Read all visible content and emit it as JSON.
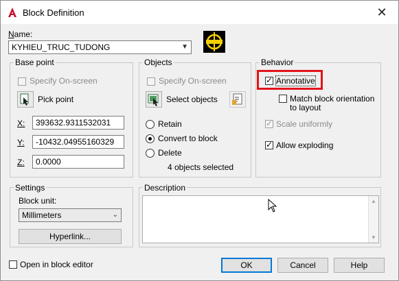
{
  "window": {
    "title": "Block Definition",
    "close_glyph": "✕"
  },
  "name_field": {
    "label": "Name:",
    "value": "KYHIEU_TRUC_TUDONG"
  },
  "base_point": {
    "group_title": "Base point",
    "specify_onscreen": "Specify On-screen",
    "pick_point": "Pick point",
    "x_label": "X:",
    "x_value": "393632.9311532031",
    "y_label": "Y:",
    "y_value": "-10432.04955160329",
    "z_label": "Z:",
    "z_value": "0.0000"
  },
  "objects": {
    "group_title": "Objects",
    "specify_onscreen": "Specify On-screen",
    "select_objects": "Select objects",
    "retain": "Retain",
    "convert_to_block": "Convert to block",
    "delete": "Delete",
    "selected_count": "4 objects selected"
  },
  "behavior": {
    "group_title": "Behavior",
    "annotative": "Annotative",
    "match_orientation_1": "Match block orientation",
    "match_orientation_2": "to layout",
    "scale_uniformly": "Scale uniformly",
    "allow_exploding": "Allow exploding"
  },
  "settings": {
    "group_title": "Settings",
    "block_unit_label": "Block unit:",
    "block_unit_value": "Millimeters",
    "hyperlink": "Hyperlink..."
  },
  "description": {
    "group_title": "Description"
  },
  "footer": {
    "open_in_editor": "Open in block editor",
    "ok": "OK",
    "cancel": "Cancel",
    "help": "Help"
  },
  "colors": {
    "highlight": "#e3141a",
    "accent": "#0078d7",
    "app_icon": "#c8102e"
  }
}
